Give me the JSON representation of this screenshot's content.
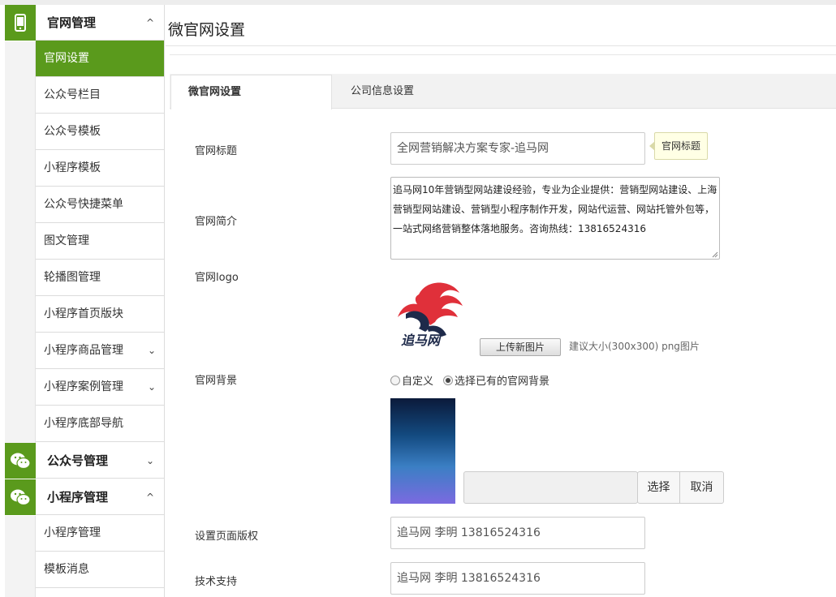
{
  "page": {
    "title": "微官网设置"
  },
  "sidebar": {
    "groups": [
      {
        "label": "官网管理",
        "arrow": "^",
        "icon": "phone-icon"
      },
      {
        "label": "公众号管理",
        "arrow": "⌄",
        "icon": "wechat-icon"
      },
      {
        "label": "小程序管理",
        "arrow": "^",
        "icon": "wechat-icon"
      }
    ],
    "items": [
      {
        "label": "官网设置",
        "arrow": ""
      },
      {
        "label": "公众号栏目",
        "arrow": ""
      },
      {
        "label": "公众号模板",
        "arrow": ""
      },
      {
        "label": "小程序模板",
        "arrow": ""
      },
      {
        "label": "公众号快捷菜单",
        "arrow": ""
      },
      {
        "label": "图文管理",
        "arrow": ""
      },
      {
        "label": "轮播图管理",
        "arrow": ""
      },
      {
        "label": "小程序首页版块",
        "arrow": ""
      },
      {
        "label": "小程序商品管理",
        "arrow": "⌄"
      },
      {
        "label": "小程序案例管理",
        "arrow": "⌄"
      },
      {
        "label": "小程序底部导航",
        "arrow": ""
      }
    ],
    "sub_items": [
      {
        "label": "小程序管理"
      },
      {
        "label": "模板消息"
      }
    ]
  },
  "tabs": [
    {
      "label": "微官网设置",
      "active": true
    },
    {
      "label": "公司信息设置",
      "active": false
    }
  ],
  "form": {
    "site_title": {
      "label": "官网标题",
      "value": "全网营销解决方案专家-追马网",
      "tip": "官网标题"
    },
    "site_intro": {
      "label": "官网简介",
      "lines": [
        "追马网10年营销型网站建设经验，专业为企业提供：营销型网站建设、上海",
        "营销型网站建设、营销型小程序制作开发，网站代运营、网站托管外包等，",
        "一站式网络营销整体落地服务。咨询热线：13816524316"
      ]
    },
    "site_logo": {
      "label": "官网logo",
      "logo_text": "追马网",
      "upload_label": "上传新图片",
      "hint": "建议大小(300x300) png图片"
    },
    "site_bg": {
      "label": "官网背景",
      "options": [
        {
          "label": "自定义",
          "checked": false
        },
        {
          "label": "选择已有的官网背景",
          "checked": true
        }
      ],
      "select_label": "选择",
      "cancel_label": "取消"
    },
    "copyright": {
      "label": "设置页面版权",
      "value": "追马网  李明 13816524316"
    },
    "tech_support": {
      "label": "技术支持",
      "value": "追马网  李明 13816524316"
    }
  },
  "colors": {
    "accent": "#5a9a1c",
    "tip_bg": "#ffffe5"
  }
}
